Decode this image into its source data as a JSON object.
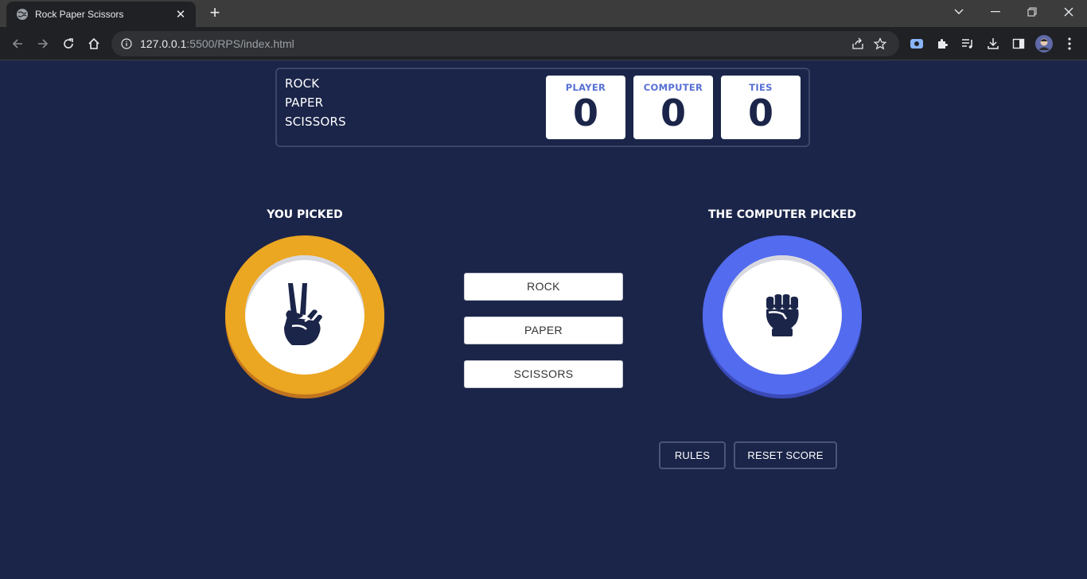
{
  "browser": {
    "tab_title": "Rock Paper Scissors",
    "url_host": "127.0.0.1",
    "url_path": ":5500/RPS/index.html"
  },
  "header": {
    "lines": [
      "ROCK",
      "PAPER",
      "SCISSORS"
    ]
  },
  "scores": [
    {
      "label": "PLAYER",
      "value": "0"
    },
    {
      "label": "COMPUTER",
      "value": "0"
    },
    {
      "label": "TIES",
      "value": "0"
    }
  ],
  "game": {
    "you_picked_label": "YOU PICKED",
    "computer_picked_label": "THE COMPUTER PICKED",
    "player_choice_icon": "scissors-hand-icon",
    "computer_choice_icon": "rock-fist-icon",
    "player_ring_color": "#eba622",
    "computer_ring_color": "#536bef"
  },
  "choices": [
    "ROCK",
    "PAPER",
    "SCISSORS"
  ],
  "actions": {
    "rules_label": "RULES",
    "reset_label": "RESET SCORE"
  }
}
